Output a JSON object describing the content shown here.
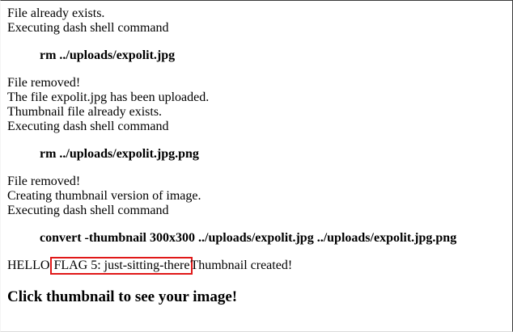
{
  "log": {
    "block1": [
      "File already exists.",
      "Executing dash shell command"
    ],
    "command1": "rm ../uploads/expolit.jpg",
    "block2": [
      "File removed!",
      "The file expolit.jpg has been uploaded.",
      "Thumbnail file already exists.",
      "Executing dash shell command"
    ],
    "command2": "rm ../uploads/expolit.jpg.png",
    "block3": [
      "File removed!",
      "Creating thumbnail version of image.",
      "Executing dash shell command"
    ],
    "command3": "convert -thumbnail 300x300 ../uploads/expolit.jpg ../uploads/expolit.jpg.png",
    "result": {
      "prefix": "HELLO ",
      "flag": "FLAG 5: just-sitting-there",
      "suffix": "Thumbnail created!"
    },
    "heading": "Click thumbnail to see your image!"
  },
  "colors": {
    "highlight_box": "#e01818",
    "text": "#000000",
    "background": "#ffffff"
  }
}
